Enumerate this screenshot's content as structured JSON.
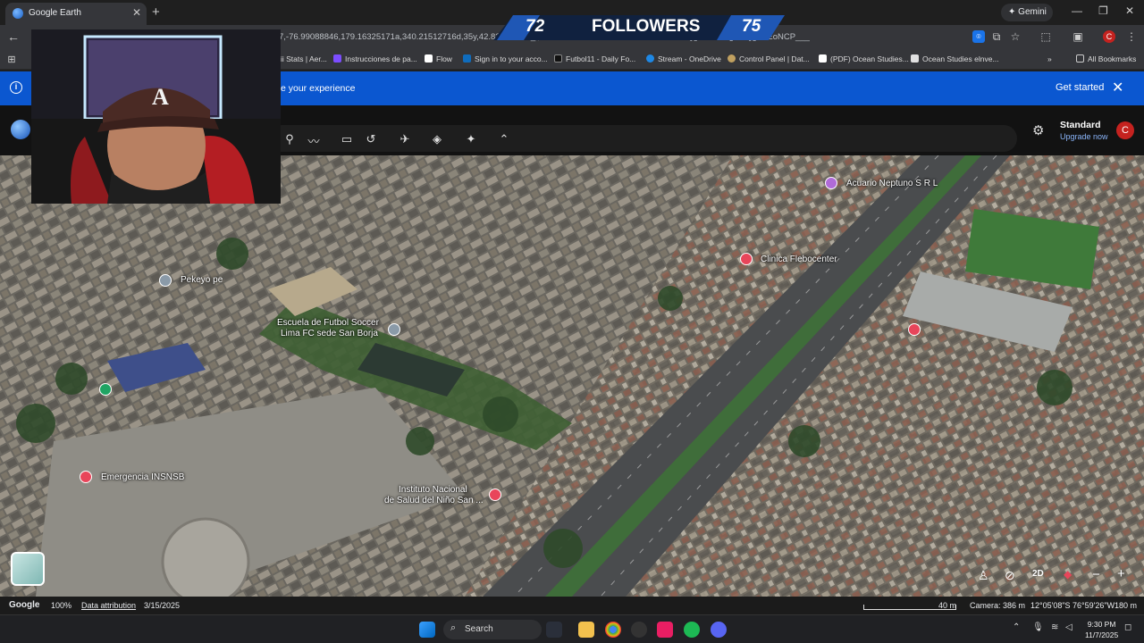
{
  "browser": {
    "tab_title": "Google Earth",
    "new_tab_symbol": "+",
    "close_symbol": "✕",
    "gemini_label": "Gemini",
    "url": "7,-76.99088846,179.16325171a,340.21512716d,35y,42.8396728..._l,data=...ChRC...GPcGEPAIfr5J4B0f1JAQgIIAToDCgEwQgIIAEoNCP___",
    "bookmarks": [
      "ii Stats | Aer...",
      "Instrucciones de pa...",
      "Flow",
      "Sign in to your acco...",
      "Futbol11 - Daily Fo...",
      "Stream - OneDrive",
      "Control Panel | Dat...",
      "(PDF) Ocean Studies...",
      "Ocean Studies elnve..."
    ],
    "all_bookmarks": "All Bookmarks",
    "avatar_letter": "C"
  },
  "banner": {
    "message": "e your experience",
    "action": "Get started",
    "close": "✕"
  },
  "earth": {
    "plan": "Standard",
    "upgrade": "Upgrade now",
    "avatar_letter": "C"
  },
  "places": [
    {
      "name": "Acuario Neptuno S R L",
      "kind": "shop",
      "color": "#b06bd8"
    },
    {
      "name": "Clinica Flebocenter",
      "kind": "hospital",
      "color": "#e8455a"
    },
    {
      "name": "Pekeyo pe",
      "kind": "generic",
      "color": "#8a9aa8"
    },
    {
      "name": "Escuela de Futbol Soccer",
      "kind": "school",
      "color": "#8a9aa8"
    },
    {
      "name": "Lima FC sede San Borja",
      "kind": "school",
      "color": "#8a9aa8"
    },
    {
      "name": "Emergencia INSNSB",
      "kind": "hospital",
      "color": "#e8455a"
    },
    {
      "name": "Instituto Nacional",
      "kind": "hospital",
      "color": "#e8455a"
    },
    {
      "name": "de Salud del Niño San ...",
      "kind": "hospital",
      "color": "#e8455a"
    },
    {
      "name": "",
      "kind": "park",
      "color": "#1fa463"
    },
    {
      "name": "",
      "kind": "hospital",
      "color": "#e8455a"
    }
  ],
  "map_controls": {
    "mode_2d": "2D"
  },
  "status": {
    "brand": "Google",
    "zoom": "100%",
    "attribution": "Data attribution",
    "date": "3/15/2025",
    "scale": "40 m",
    "camera": "Camera: 386 m",
    "coords": "12°05'08\"S 76°59'26\"W",
    "elevation": "180 m"
  },
  "taskbar": {
    "search": "Search",
    "time": "9:30 PM",
    "date": "11/7/2025"
  },
  "overlay": {
    "followers_current": "72",
    "followers_label": "FOLLOWERS",
    "followers_goal": "75"
  }
}
